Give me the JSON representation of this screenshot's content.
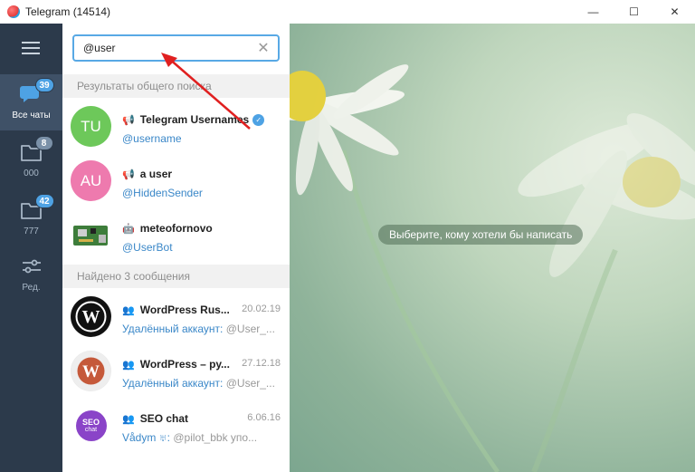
{
  "window": {
    "title": "Telegram (14514)",
    "controls": [
      "—",
      "☐",
      "✕"
    ]
  },
  "folders": [
    {
      "label": "Все чаты",
      "badge": "39",
      "badge_color": "#4ea2e4",
      "active": true
    },
    {
      "label": "000",
      "badge": "8",
      "badge_color": "#7b91a8",
      "active": false
    },
    {
      "label": "777",
      "badge": "42",
      "badge_color": "#4ea2e4",
      "active": false
    },
    {
      "label": "Ред.",
      "badge": "",
      "active": false
    }
  ],
  "search": {
    "value": "@user",
    "clear_icon": "✕"
  },
  "sections": {
    "global_results": "Результаты общего поиска",
    "found_messages": "Найдено 3 сообщения"
  },
  "global_results": [
    {
      "initials": "TU",
      "avatar_color": "#6dc85a",
      "title": "Telegram Usernames",
      "username": "@username",
      "kind": "channel",
      "verified": true
    },
    {
      "initials": "AU",
      "avatar_color": "#ee7aae",
      "title": "a user",
      "username": "@HiddenSender",
      "kind": "channel",
      "verified": false
    },
    {
      "initials": "",
      "avatar_color": "#5a7a4a",
      "title": "meteofornovo",
      "username": "@UserBot",
      "kind": "bot",
      "verified": false
    }
  ],
  "messages": [
    {
      "title": "WordPress Rus...",
      "date": "20.02.19",
      "author": "Удалённый аккаунт:",
      "text": " @User_..."
    },
    {
      "title": "WordPress – ру...",
      "date": "27.12.18",
      "author": "Удалённый аккаунт:",
      "text": " @User_..."
    },
    {
      "title": "SEO chat",
      "date": "6.06.16",
      "author": "Vådym ♅:",
      "text": " @pilot_bbk упо...",
      "seo_top": "SEO",
      "seo_bottom": "chat"
    }
  ],
  "chat_area": {
    "empty_text": "Выберите, кому хотели бы написать",
    "accent": "#4ea2e4"
  }
}
